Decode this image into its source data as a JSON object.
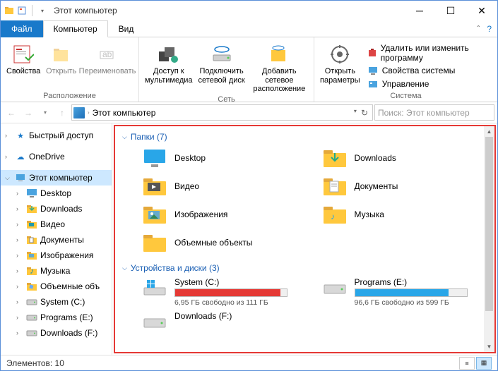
{
  "window": {
    "title": "Этот компьютер"
  },
  "tabs": {
    "file": "Файл",
    "computer": "Компьютер",
    "view": "Вид"
  },
  "ribbon": {
    "group_location": "Расположение",
    "group_network": "Сеть",
    "group_system": "Система",
    "properties": "Свойства",
    "open": "Открыть",
    "rename": "Переименовать",
    "media_access": "Доступ к\nмультимедиа",
    "map_drive": "Подключить\nсетевой диск",
    "add_net": "Добавить сетевое\nрасположение",
    "open_params": "Открыть\nпараметры",
    "uninstall": "Удалить или изменить программу",
    "sys_props": "Свойства системы",
    "manage": "Управление"
  },
  "address": {
    "path": "Этот компьютер",
    "search_placeholder": "Поиск: Этот компьютер"
  },
  "sidebar": {
    "quick": "Быстрый доступ",
    "onedrive": "OneDrive",
    "thispc": "Этот компьютер",
    "items": [
      {
        "label": "Desktop",
        "icon": "desktop"
      },
      {
        "label": "Downloads",
        "icon": "downloads"
      },
      {
        "label": "Видео",
        "icon": "video"
      },
      {
        "label": "Документы",
        "icon": "docs"
      },
      {
        "label": "Изображения",
        "icon": "images"
      },
      {
        "label": "Музыка",
        "icon": "music"
      },
      {
        "label": "Объемные объ",
        "icon": "3d"
      },
      {
        "label": "System (C:)",
        "icon": "drive"
      },
      {
        "label": "Programs (E:)",
        "icon": "drive"
      },
      {
        "label": "Downloads (F:)",
        "icon": "drive"
      }
    ]
  },
  "content": {
    "folders_header": "Папки (7)",
    "drives_header": "Устройства и диски (3)",
    "folders": [
      {
        "label": "Desktop",
        "type": "desktop"
      },
      {
        "label": "Downloads",
        "type": "folder-down"
      },
      {
        "label": "Видео",
        "type": "video"
      },
      {
        "label": "Документы",
        "type": "docs"
      },
      {
        "label": "Изображения",
        "type": "images"
      },
      {
        "label": "Музыка",
        "type": "music"
      },
      {
        "label": "Объемные объекты",
        "type": "folder"
      }
    ],
    "drives": [
      {
        "name": "System (C:)",
        "stat": "6,95 ГБ свободно из 111 ГБ",
        "fill": 94,
        "color": "#e53935",
        "icon": "windrive"
      },
      {
        "name": "Programs (E:)",
        "stat": "96,6 ГБ свободно из 599 ГБ",
        "fill": 84,
        "color": "#29a6e8",
        "icon": "drive"
      },
      {
        "name": "Downloads (F:)",
        "stat": "",
        "fill": 0,
        "color": "#29a6e8",
        "icon": "drive"
      }
    ]
  },
  "status": {
    "items": "Элементов: 10"
  }
}
